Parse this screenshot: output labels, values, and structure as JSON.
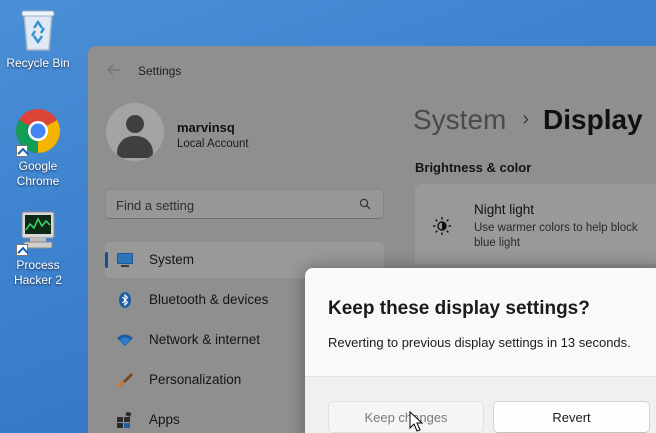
{
  "desktop": {
    "icons": [
      {
        "label": "Recycle Bin",
        "icon": "recycle-bin-icon"
      },
      {
        "label": "Google Chrome",
        "icon": "chrome-icon"
      },
      {
        "label": "Process Hacker 2",
        "icon": "process-hacker-icon"
      }
    ]
  },
  "settings": {
    "title": "Settings",
    "user": {
      "name": "marvinsq",
      "account_type": "Local Account"
    },
    "search": {
      "placeholder": "Find a setting"
    },
    "nav": [
      {
        "label": "System",
        "icon": "monitor-icon",
        "selected": true
      },
      {
        "label": "Bluetooth & devices",
        "icon": "bluetooth-icon"
      },
      {
        "label": "Network & internet",
        "icon": "wifi-icon"
      },
      {
        "label": "Personalization",
        "icon": "brush-icon"
      },
      {
        "label": "Apps",
        "icon": "apps-icon"
      }
    ],
    "breadcrumb": {
      "parent": "System",
      "separator": "›",
      "current": "Display"
    },
    "section": "Brightness & color",
    "night_light": {
      "title": "Night light",
      "description": "Use warmer colors to help block blue light"
    }
  },
  "dialog": {
    "title": "Keep these display settings?",
    "message": "Reverting to previous display settings in 13 seconds.",
    "keep_label": "Keep changes",
    "revert_label": "Revert"
  },
  "colors": {
    "accent": "#0067c0",
    "desktop": "#3d82cf",
    "dim_window": "#8f8f8f"
  }
}
